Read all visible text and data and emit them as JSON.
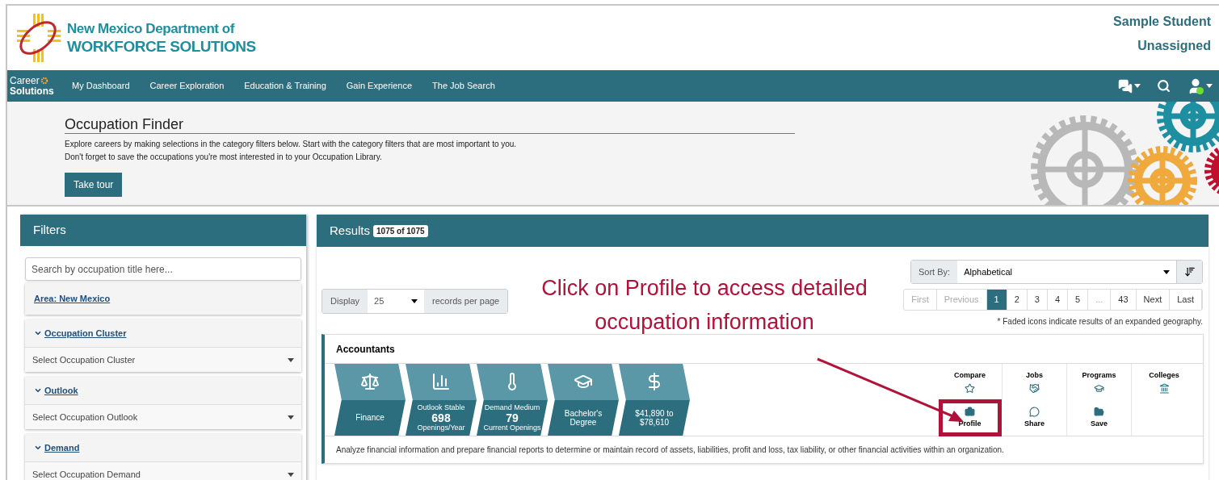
{
  "header": {
    "logo_line1": "New Mexico Department of",
    "logo_line2": "WORKFORCE SOLUTIONS",
    "user_name": "Sample Student",
    "user_status": "Unassigned"
  },
  "nav": {
    "brand_top": "Career",
    "brand_bottom": "Solutions",
    "items": [
      "My Dashboard",
      "Career Exploration",
      "Education & Training",
      "Gain Experience",
      "The Job Search"
    ]
  },
  "banner": {
    "title": "Occupation Finder",
    "lines": [
      "Explore careers by making selections in the category filters below. Start with the category filters that are most important to you.",
      "Don't forget to save the occupations you're most interested in to your Occupation Library."
    ],
    "button": "Take tour"
  },
  "filters": {
    "title": "Filters",
    "search": {
      "placeholder": "Search by occupation title here..."
    },
    "area": "Area: New Mexico",
    "sections": [
      {
        "label": "Occupation Cluster",
        "select": "Select Occupation Cluster"
      },
      {
        "label": "Outlook",
        "select": "Select Occupation Outlook"
      },
      {
        "label": "Demand",
        "select": "Select Occupation Demand"
      }
    ]
  },
  "results": {
    "title": "Results",
    "count": "1075 of 1075",
    "display": {
      "label": "Display",
      "value": "25",
      "suffix": "records per page"
    },
    "sort": {
      "label": "Sort By:",
      "value": "Alphabetical"
    },
    "pagination": [
      {
        "label": "First",
        "selected": false,
        "disabled": true
      },
      {
        "label": "Previous",
        "selected": false,
        "disabled": true
      },
      {
        "label": "1",
        "selected": true,
        "disabled": false
      },
      {
        "label": "2",
        "selected": false,
        "disabled": false
      },
      {
        "label": "3",
        "selected": false,
        "disabled": false
      },
      {
        "label": "4",
        "selected": false,
        "disabled": false
      },
      {
        "label": "5",
        "selected": false,
        "disabled": false
      },
      {
        "label": "...",
        "selected": false,
        "disabled": true
      },
      {
        "label": "43",
        "selected": false,
        "disabled": false
      },
      {
        "label": "Next",
        "selected": false,
        "disabled": false
      },
      {
        "label": "Last",
        "selected": false,
        "disabled": false
      }
    ],
    "note": "* Faded icons indicate results of an expanded geography.",
    "annotation": "Click on Profile to access detailed occupation information",
    "occupation": {
      "title": "Accountants",
      "tiles": [
        {
          "kind": "finance",
          "top": "Finance"
        },
        {
          "kind": "outlook",
          "top": "Outlook Stable",
          "value": "698",
          "bottom": "Openings/Year"
        },
        {
          "kind": "demand",
          "top": "Demand Medium",
          "value": "79",
          "bottom": "Current Openings"
        },
        {
          "kind": "education",
          "top": "Bachelor's Degree"
        },
        {
          "kind": "wage",
          "top": "$41,890 to $78,610"
        }
      ],
      "actions": [
        {
          "kind": "compare",
          "label": "Compare",
          "highlighted": false
        },
        {
          "kind": "jobs",
          "label": "Jobs",
          "highlighted": false
        },
        {
          "kind": "programs",
          "label": "Programs",
          "highlighted": false
        },
        {
          "kind": "colleges",
          "label": "Colleges",
          "highlighted": false
        },
        {
          "kind": "profile",
          "label": "Profile",
          "highlighted": true
        },
        {
          "kind": "share",
          "label": "Share",
          "highlighted": false
        },
        {
          "kind": "save",
          "label": "Save",
          "highlighted": false
        }
      ],
      "description": "Analyze financial information and prepare financial reports to determine or maintain record of assets, liabilities, profit and loss, tax liability, or other financial activities within an organization."
    }
  }
}
